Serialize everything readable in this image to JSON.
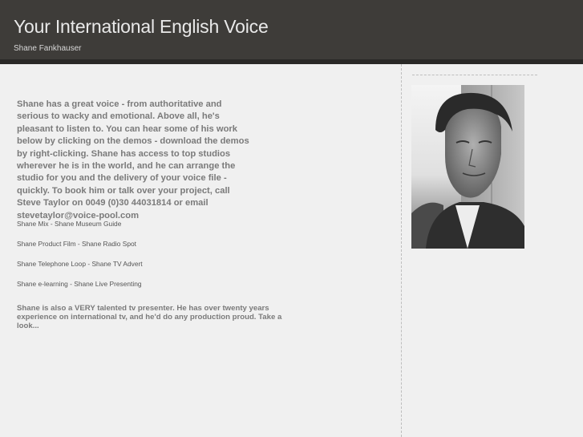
{
  "header": {
    "title": "Your International English Voice",
    "subtitle": "Shane Fankhauser"
  },
  "main": {
    "intro": "Shane has a great voice - from authoritative and serious to wacky and emotional. Above all, he's pleasant to listen to. You can hear some of his work below by clicking on the demos - download the demos by right-clicking. Shane has access to top studios wherever he is in the world, and he can arrange the studio for you and the delivery of your voice file - quickly. To book him or talk over your project, call Steve Taylor on 0049 (0)30 44031814 or email stevetaylor@voice-pool.com",
    "demo_rows": [
      {
        "left": "Shane Mix",
        "sep": " - ",
        "right": "Shane Museum Guide"
      },
      {
        "left": "Shane Product Film",
        "sep": " - ",
        "right": "Shane Radio Spot"
      },
      {
        "left": "Shane Telephone Loop",
        "sep": " - ",
        "right": "Shane TV Advert"
      },
      {
        "left": "Shane e-learning",
        "sep": " - ",
        "right": "Shane Live Presenting"
      }
    ],
    "outro": "Shane is also a VERY talented tv presenter. He has over twenty years experience on international tv, and he'd do any production proud. Take a look..."
  },
  "sidebar": {
    "photo_icon": "portrait-photo"
  },
  "colors": {
    "header_bg": "#3e3c39",
    "page_bg": "#f0f0f0",
    "text_gray": "#7a7a7a"
  }
}
